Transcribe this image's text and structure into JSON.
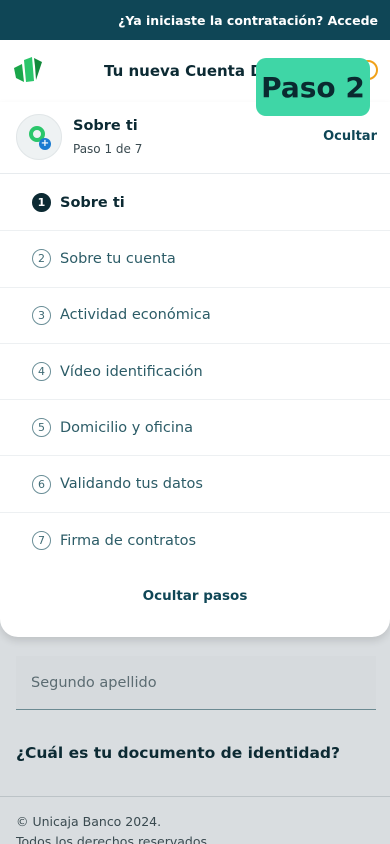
{
  "topbar": {
    "text": "¿Ya iniciaste la contratación? Accede"
  },
  "header": {
    "title": "Tu nueva Cuenta Digital",
    "logo": "unicaja-logo",
    "help_icon": "help-icon"
  },
  "badge": {
    "text": "Paso 2"
  },
  "step_header": {
    "title": "Sobre ti",
    "subtitle": "Paso 1 de 7",
    "hide_label": "Ocultar"
  },
  "steps": [
    {
      "num": "1",
      "label": "Sobre ti",
      "active": true
    },
    {
      "num": "2",
      "label": "Sobre tu cuenta",
      "active": false
    },
    {
      "num": "3",
      "label": "Actividad económica",
      "active": false
    },
    {
      "num": "4",
      "label": "Vídeo identificación",
      "active": false
    },
    {
      "num": "5",
      "label": "Domicilio y oficina",
      "active": false
    },
    {
      "num": "6",
      "label": "Validando tus datos",
      "active": false
    },
    {
      "num": "7",
      "label": "Firma de contratos",
      "active": false
    }
  ],
  "hide_steps_label": "Ocultar pasos",
  "form": {
    "second_surname_placeholder": "Segundo apellido",
    "question": "¿Cuál es tu documento de identidad?"
  },
  "footer": {
    "copyright": "© Unicaja Banco 2024.",
    "rights": "Todos los derechos reservados."
  },
  "colors": {
    "topbar": "#0f4656",
    "accent": "#3fd6a6",
    "brand_green": "#2bc66b"
  }
}
